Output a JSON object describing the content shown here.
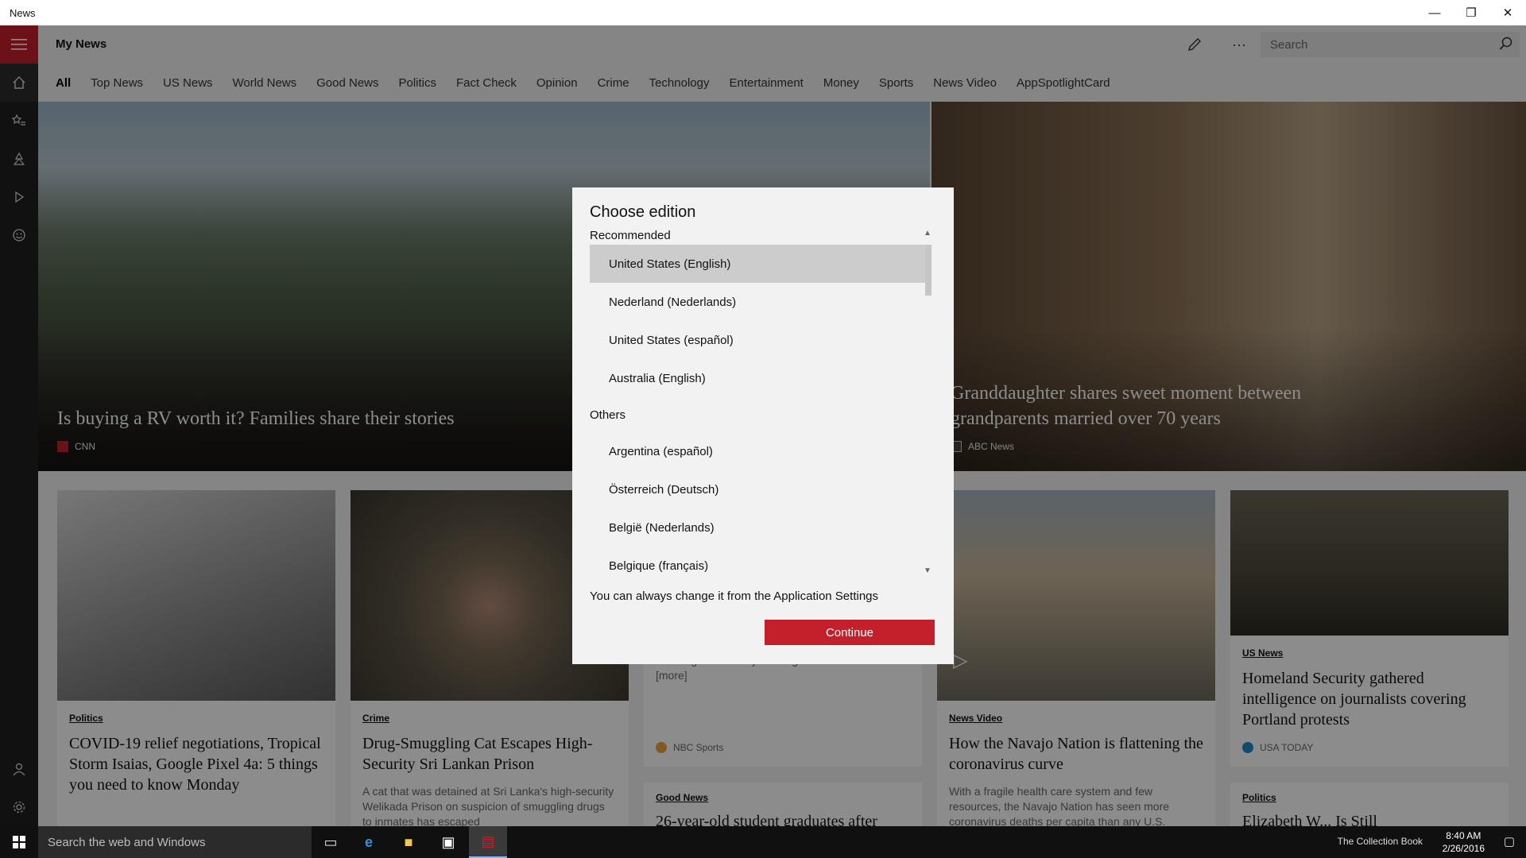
{
  "window": {
    "title": "News",
    "controls": [
      "—",
      "❐",
      "✕"
    ]
  },
  "header": {
    "page_title": "My News",
    "search_placeholder": "Search",
    "more_label": "···"
  },
  "tabs": [
    "All",
    "Top News",
    "US News",
    "World News",
    "Good News",
    "Politics",
    "Fact Check",
    "Opinion",
    "Crime",
    "Technology",
    "Entertainment",
    "Money",
    "Sports",
    "News Video",
    "AppSpotlightCard"
  ],
  "hero": [
    {
      "title": "Is buying a RV worth it? Families share their stories",
      "source": "CNN"
    },
    {
      "title": "Granddaughter shares sweet moment between grandparents married over 70 years",
      "source": "ABC News"
    }
  ],
  "cards": {
    "c1": {
      "category": "Politics",
      "headline": "COVID-19 relief negotiations, Tropical Storm Isaias, Google Pixel 4a: 5 things you need to know Monday"
    },
    "c2": {
      "category": "Crime",
      "headline": "Drug-Smuggling Cat Escapes High-Security Sri Lankan Prison",
      "summary": "A cat that was detained at Sri Lanka's high-security Welikada Prison on suspicion of smuggling drugs to inmates has escaped"
    },
    "c3": {
      "summary_partial": "of losing the cell-boyle college and a desire",
      "more": "[more]",
      "source": "NBC Sports"
    },
    "c4": {
      "category": "Good News",
      "headline_partial": "26-year-old student graduates after"
    },
    "c5": {
      "category": "News Video",
      "headline": "How the Navajo Nation is flattening the coronavirus curve",
      "summary": "With a fragile health care system and few resources, the Navajo Nation has seen more coronavirus deaths per capita than any U.S."
    },
    "c6": {
      "category": "US News",
      "headline": "Homeland Security gathered intelligence on journalists covering Portland protests",
      "source": "USA TODAY"
    },
    "c7": {
      "category": "Politics",
      "headline_partial": "Elizabeth W... Is Still"
    }
  },
  "dialog": {
    "title": "Choose edition",
    "recommended_label": "Recommended",
    "recommended": [
      "United States (English)",
      "Nederland (Nederlands)",
      "United States (español)",
      "Australia (English)"
    ],
    "others_label": "Others",
    "others": [
      "Argentina (español)",
      "Österreich (Deutsch)",
      "België (Nederlands)",
      "Belgique (français)"
    ],
    "selected": "United States (English)",
    "note": "You can always change it from the Application Settings",
    "continue_label": "Continue"
  },
  "taskbar": {
    "search_placeholder": "Search the web and Windows",
    "time": "8:40 AM",
    "date": "2/26/2016",
    "watermark": "The Collection Book"
  },
  "colors": {
    "accent": "#c4202b",
    "rail": "#1f1f1f",
    "dialog_bg": "#f2f2f2",
    "selected_item": "#cccccc"
  },
  "icons": [
    "hamburger-icon",
    "home-icon",
    "star-list-icon",
    "local-icon",
    "video-icon",
    "smile-icon",
    "person-icon",
    "settings-icon",
    "pencil-icon",
    "search-icon",
    "windows-icon",
    "task-view-icon",
    "edge-icon",
    "folder-icon",
    "store-icon",
    "news-icon"
  ]
}
